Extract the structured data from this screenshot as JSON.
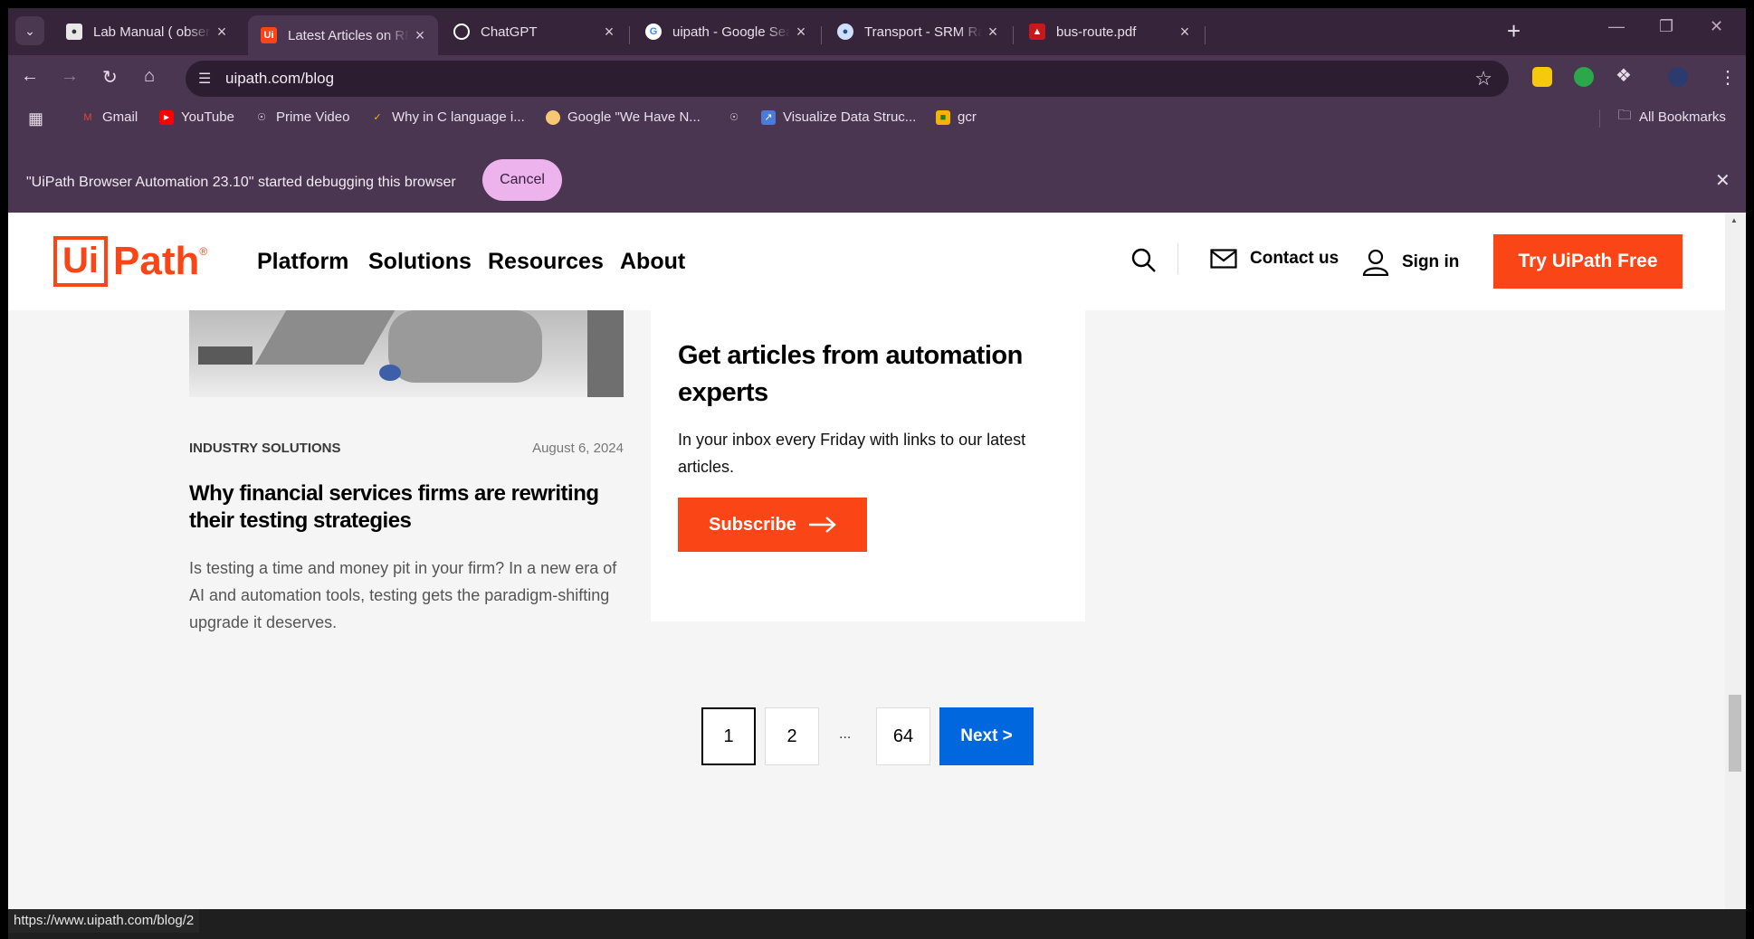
{
  "browser": {
    "tabs": [
      {
        "title": "Lab Manual ( observation)",
        "favicon": "classroom-icon"
      },
      {
        "title": "Latest Articles on RPA News",
        "favicon": "uipath-icon",
        "active": true
      },
      {
        "title": "ChatGPT",
        "favicon": "openai-icon"
      },
      {
        "title": "uipath - Google Search",
        "favicon": "google-icon"
      },
      {
        "title": "Transport - SRM Ramapuram",
        "favicon": "srm-icon"
      },
      {
        "title": "bus-route.pdf",
        "favicon": "pdf-icon"
      }
    ],
    "new_tab": "+",
    "url": "uipath.com/blog",
    "bookmarks": [
      {
        "label": "Gmail",
        "icon": "gmail-icon"
      },
      {
        "label": "YouTube",
        "icon": "youtube-icon"
      },
      {
        "label": "Prime Video",
        "icon": "globe-icon"
      },
      {
        "label": "Why in C language i...",
        "icon": "bookmark-icon"
      },
      {
        "label": "Google \"We Have N...",
        "icon": "bookmark-icon"
      },
      {
        "label": "",
        "icon": "globe-icon"
      },
      {
        "label": "Visualize Data Struc...",
        "icon": "bookmark-icon"
      },
      {
        "label": "gcr",
        "icon": "classroom-icon"
      }
    ],
    "all_bookmarks": "All Bookmarks",
    "infobar_message": "\"UiPath Browser Automation 23.10\" started debugging this browser",
    "infobar_cancel": "Cancel",
    "status_url": "https://www.uipath.com/blog/2"
  },
  "site": {
    "logo_ui": "Ui",
    "logo_path": "Path",
    "logo_reg": "®",
    "nav": [
      "Platform",
      "Solutions",
      "Resources",
      "About"
    ],
    "contact": "Contact us",
    "signin": "Sign in",
    "try_button": "Try UiPath Free"
  },
  "article": {
    "category": "INDUSTRY SOLUTIONS",
    "date": "August 6, 2024",
    "title": "Why financial services firms are rewriting their testing strategies",
    "description": "Is testing a time and money pit in your firm? In a new era of AI and automation tools, testing gets the paradigm-shifting upgrade it deserves."
  },
  "newsletter": {
    "title": "Get articles from automation experts",
    "description": "In your inbox every Friday with links to our latest articles.",
    "button": "Subscribe"
  },
  "pagination": {
    "pages": [
      "1",
      "2",
      "64"
    ],
    "current": "1",
    "ellipsis": "...",
    "next": "Next  >"
  },
  "colors": {
    "brand_orange": "#fa4616",
    "next_blue": "#0067df",
    "browser_frame": "#4b3651"
  }
}
